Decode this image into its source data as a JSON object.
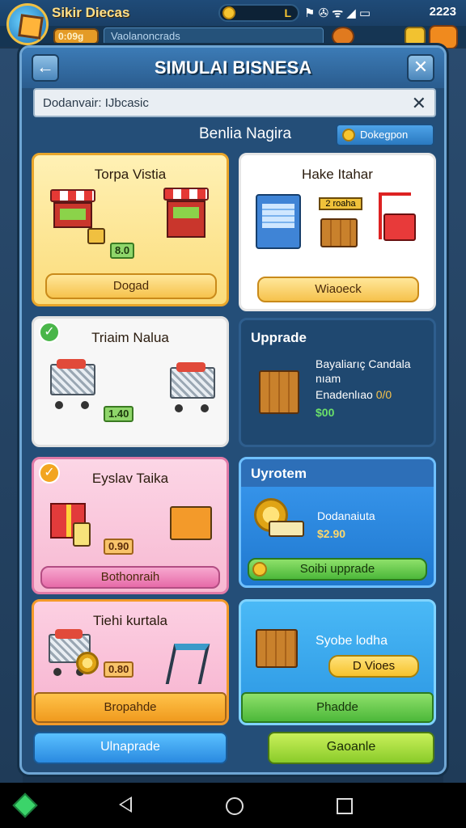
{
  "status_bar": {
    "game_title": "Sikir Diecas",
    "coin_value": "L",
    "sys_icons": "⚑ ✇ ᯤ ◢ ▭",
    "time": "2223",
    "gold_value": "0:09g",
    "search_text": "Vaolanoncrads"
  },
  "modal": {
    "title": "SIMULAI BISNESΑ",
    "back_glyph": "←",
    "close_glyph": "✕",
    "search_value": "Dodanvair: IJbcasic",
    "search_clear": "✕",
    "section_label": "Benlia Nagira",
    "dropdown_label": "Dokegpon"
  },
  "cards": [
    {
      "title": "Torpa Vistia",
      "price": "8.0",
      "button": "Dogad"
    },
    {
      "title": "Hake Itahar",
      "sign": "2 roaha",
      "button": "Wiaoeck"
    },
    {
      "title": "Triaim Nalua",
      "price": "1.40",
      "badge": "✓"
    },
    {
      "title": "Upprade",
      "desc1": "Bayaliarıç Candala",
      "desc2": "nıam",
      "desc3": "Enadenlıao",
      "desc3_val": "0/0",
      "price": "$00"
    },
    {
      "title": "Eyslav Taika",
      "price": "0.90",
      "button": "Bothonraih",
      "badge": "✓"
    },
    {
      "title": "Uyrotem",
      "desc": "Dodanaiuta",
      "price": "$2.90",
      "button": "Soibi upprade"
    },
    {
      "title": "Tiehi kurtala",
      "price": "0.80",
      "button": "Bropahde"
    },
    {
      "title": "Syobe lodha",
      "pill": "D Vioes",
      "button": "Phadde"
    }
  ],
  "bottom": {
    "left_button": "Ulnaprade",
    "right_button": "Gaoanle"
  },
  "colors": {
    "card_yellow": "#fbe08a",
    "card_white": "#ffffff",
    "card_dark": "#1f4870",
    "card_pink": "#f9c3d9",
    "card_blue": "#2d8be0",
    "card_sky": "#35a6ee"
  }
}
